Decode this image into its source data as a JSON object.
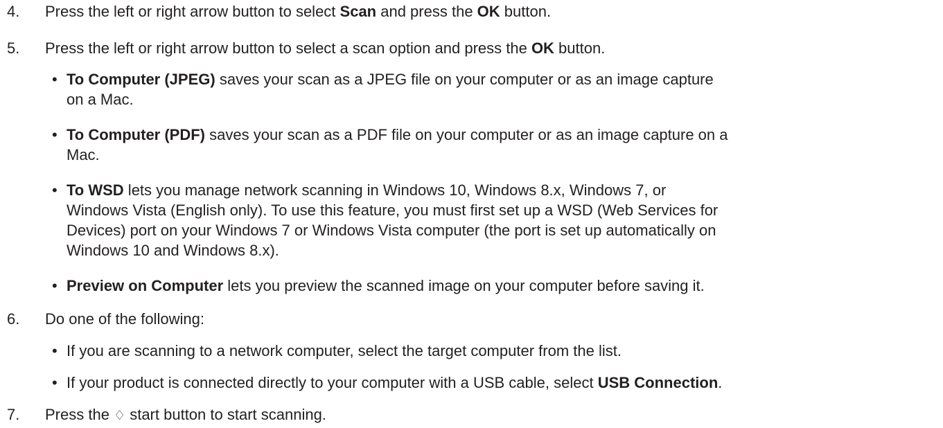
{
  "steps": [
    {
      "number": "4.",
      "parts": [
        "Press the left or right arrow button to select ",
        "Scan",
        " and press the ",
        "OK",
        " button."
      ]
    },
    {
      "number": "5.",
      "parts": [
        "Press the left or right arrow button to select a scan option and press the ",
        "OK",
        " button."
      ],
      "bullets": [
        {
          "term": "To Computer (JPEG)",
          "text": " saves your scan as a JPEG file on your computer or as an image capture",
          "text2": "on a Mac."
        },
        {
          "term": "To Computer (PDF)",
          "text": " saves your scan as a PDF file on your computer or as an image capture on a",
          "text2": "Mac."
        },
        {
          "term": "To WSD",
          "text": " lets you manage network scanning in Windows 10, Windows 8.x, Windows 7, or",
          "line2": "Windows Vista (English only). To use this feature, you must first set up a WSD (Web Services for",
          "line3": "Devices) port on your Windows 7 or Windows Vista computer (the port is set up automatically on",
          "line4": "Windows 10 and Windows 8.x)."
        },
        {
          "term": "Preview on Computer",
          "text": " lets you preview the scanned image on your computer before saving it."
        }
      ]
    },
    {
      "number": "6.",
      "parts": [
        "Do one of the following:"
      ],
      "bullets": [
        {
          "text": "If you are scanning to a network computer, select the target computer from the list."
        },
        {
          "text": "If your product is connected directly to your computer with a USB cable, select ",
          "term": "USB Connection",
          "tail": "."
        }
      ]
    },
    {
      "number": "7.",
      "parts": [
        "Press the ",
        "♢",
        " start button to start scanning."
      ],
      "icon": "start-button-icon"
    }
  ],
  "bullet_char": "•"
}
